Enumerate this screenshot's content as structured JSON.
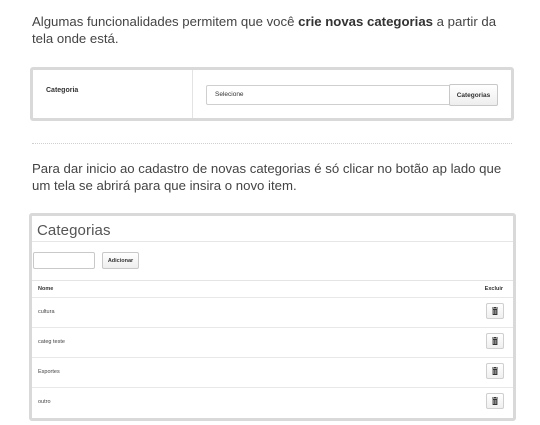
{
  "intro": {
    "text_before": "Algumas funcionalidades permitem que você ",
    "text_bold": "crie novas categorias",
    "text_after": " a partir da tela onde está."
  },
  "form_panel": {
    "label": "Categoria",
    "select_value": "Selecione",
    "button_label": "Categorias"
  },
  "explanation": {
    "text": "Para dar inicio ao cadastro de novas categorias é só clicar no botão ap lado que um tela se abrirá para que insira o novo item."
  },
  "categories_panel": {
    "title": "Categorias",
    "new_item_value": "",
    "add_button_label": "Adicionar",
    "columns": [
      "Nome",
      "Excluir"
    ],
    "rows": [
      {
        "name": "cultura"
      },
      {
        "name": "categ teste"
      },
      {
        "name": "Esportes"
      },
      {
        "name": "outro"
      }
    ],
    "delete_icon": "trash-icon"
  }
}
